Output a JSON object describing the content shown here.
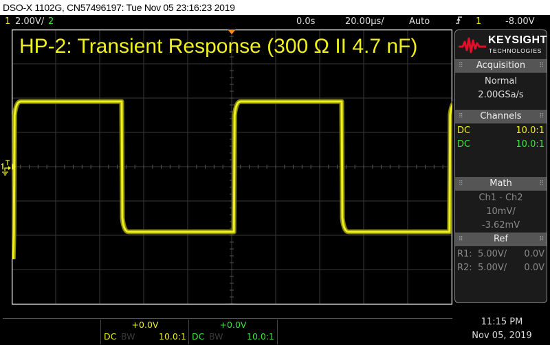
{
  "window": {
    "title": "DSO-X 1102G, CN57496197: Tue Nov 05 23:16:23 2019"
  },
  "topbar": {
    "ch1_label": "1",
    "ch1_scale": "2.00V/",
    "ch2_label": "2",
    "time_offset": "0.0s",
    "time_scale": "20.00µs/",
    "trigger_mode": "Auto",
    "trigger_edge_icon": "rising-edge",
    "trigger_source": "1",
    "trigger_level": "-8.00V"
  },
  "display": {
    "annotation": "HP-2: Transient Response (300 Ω II 4.7 nF)",
    "ch1_marker": "1",
    "trace_color": "#f0f020",
    "ch2_color": "#3ce63c",
    "trigger_marker_color": "#ff8c1a",
    "divisions": {
      "horizontal": 10,
      "vertical": 8
    },
    "waveform": {
      "type": "square",
      "high_level_div": 1.9,
      "low_level_div": -1.9,
      "rising_edges_div": [
        0.05,
        5.05,
        9.95
      ],
      "falling_edges_div": [
        2.5,
        7.5
      ]
    }
  },
  "sidebar": {
    "brand": "KEYSIGHT",
    "brand_sub": "TECHNOLOGIES",
    "acquisition": {
      "title": "Acquisition",
      "mode": "Normal",
      "rate": "2.00GSa/s"
    },
    "channels": {
      "title": "Channels",
      "rows": [
        {
          "coupling": "DC",
          "probe": "10.0:1"
        },
        {
          "coupling": "DC",
          "probe": "10.0:1"
        }
      ]
    },
    "math": {
      "title": "Math",
      "function": "Ch1 - Ch2",
      "scale": "10mV/",
      "offset": "-3.62mV"
    },
    "ref": {
      "title": "Ref",
      "rows": [
        {
          "name": "R1:",
          "scale": "5.00V/",
          "offset": "0.0V"
        },
        {
          "name": "R2:",
          "scale": "5.00V/",
          "offset": "0.0V"
        }
      ]
    }
  },
  "bottom": {
    "ch1": {
      "offset": "+0.0V",
      "coupling": "DC",
      "bw": "BW",
      "probe": "10.0:1"
    },
    "ch2": {
      "offset": "+0.0V",
      "coupling": "DC",
      "bw": "BW",
      "probe": "10.0:1"
    },
    "time": "11:15 PM",
    "date": "Nov 05, 2019"
  }
}
